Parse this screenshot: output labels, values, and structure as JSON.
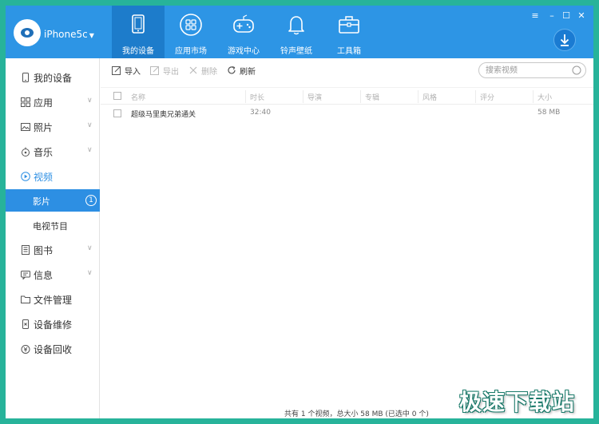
{
  "app": {
    "device_name": "iPhone5c",
    "accent_color": "#2d95e5",
    "frame_color": "#27b39a"
  },
  "nav": {
    "tabs": [
      {
        "label": "我的设备",
        "icon": "tablet-icon"
      },
      {
        "label": "应用市场",
        "icon": "apps-grid-icon"
      },
      {
        "label": "游戏中心",
        "icon": "gamepad-icon"
      },
      {
        "label": "铃声壁纸",
        "icon": "bell-icon"
      },
      {
        "label": "工具箱",
        "icon": "toolbox-icon"
      }
    ],
    "active_index": 0
  },
  "window_controls": {
    "menu": "≡",
    "minimize": "–",
    "maximize": "☐",
    "close": "✕"
  },
  "sidebar": {
    "items": [
      {
        "label": "我的设备",
        "icon": "phone-icon"
      },
      {
        "label": "应用",
        "icon": "apps-icon"
      },
      {
        "label": "照片",
        "icon": "photo-icon"
      },
      {
        "label": "音乐",
        "icon": "music-icon"
      },
      {
        "label": "视频",
        "icon": "video-play-icon"
      },
      {
        "label": "图书",
        "icon": "book-icon"
      },
      {
        "label": "信息",
        "icon": "message-icon"
      },
      {
        "label": "文件管理",
        "icon": "folder-icon"
      },
      {
        "label": "设备维修",
        "icon": "repair-icon"
      },
      {
        "label": "设备回收",
        "icon": "recycle-coin-icon"
      }
    ],
    "video_sub": [
      {
        "label": "影片",
        "count": "1"
      },
      {
        "label": "电视节目"
      }
    ]
  },
  "toolbar": {
    "import": "导入",
    "export": "导出",
    "delete": "删除",
    "refresh": "刷新",
    "search_placeholder": "搜索视频"
  },
  "table": {
    "columns": [
      "名称",
      "时长",
      "导演",
      "专辑",
      "风格",
      "评分",
      "大小"
    ],
    "rows": [
      {
        "name": "超级马里奥兄弟通关",
        "duration": "32:40",
        "director": "",
        "album": "",
        "genre": "",
        "rating": "",
        "size": "58 MB"
      }
    ]
  },
  "status": {
    "summary": "共有 1 个视频，总大小 58 MB (已选中 0 个)"
  },
  "watermark": "极速下载站"
}
